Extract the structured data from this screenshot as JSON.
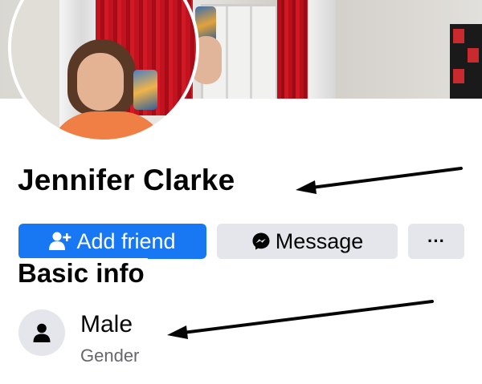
{
  "profile": {
    "name": "Jennifer Clarke"
  },
  "actions": {
    "add_friend": "Add friend",
    "message": "Message",
    "more": "···"
  },
  "basic_info": {
    "title": "Basic info",
    "gender_value": "Male",
    "gender_label": "Gender"
  },
  "icons": {
    "add_friend": "person-plus-icon",
    "message": "messenger-icon",
    "gender": "person-icon"
  },
  "colors": {
    "primary": "#1877f2",
    "secondary_button": "#e4e6eb",
    "text": "#050505",
    "muted_text": "#65676b"
  }
}
